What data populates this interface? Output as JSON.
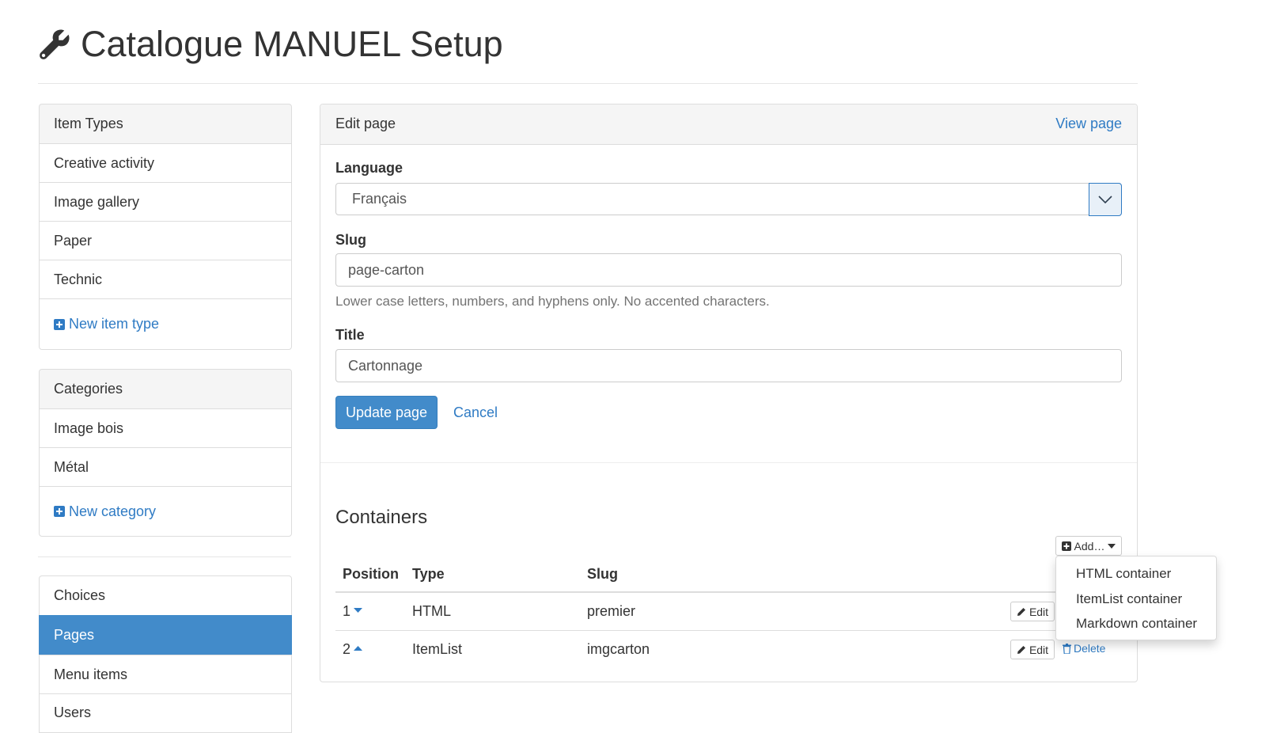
{
  "header": {
    "title": "Catalogue MANUEL Setup",
    "icon": "wrench-icon"
  },
  "sidebar": {
    "item_types": {
      "heading": "Item Types",
      "items": [
        "Creative activity",
        "Image gallery",
        "Paper",
        "Technic"
      ],
      "new_label": "New item type"
    },
    "categories": {
      "heading": "Categories",
      "items": [
        "Image bois",
        "Métal"
      ],
      "new_label": "New category"
    },
    "nav": {
      "items": [
        "Choices",
        "Pages",
        "Menu items",
        "Users"
      ],
      "active": "Pages"
    }
  },
  "main": {
    "heading": "Edit page",
    "view_link": "View page",
    "form": {
      "language_label": "Language",
      "language_value": "Français",
      "slug_label": "Slug",
      "slug_value": "page-carton",
      "slug_help": "Lower case letters, numbers, and hyphens only. No accented characters.",
      "title_label": "Title",
      "title_value": "Cartonnage",
      "submit_label": "Update page",
      "cancel_label": "Cancel"
    },
    "containers": {
      "heading": "Containers",
      "add_label": "Add…",
      "add_menu": [
        "HTML container",
        "ItemList container",
        "Markdown container"
      ],
      "columns": [
        "Position",
        "Type",
        "Slug"
      ],
      "rows": [
        {
          "position": "1",
          "type": "HTML",
          "slug": "premier",
          "edit": "Edit"
        },
        {
          "position": "2",
          "type": "ItemList",
          "slug": "imgcarton",
          "edit": "Edit",
          "delete": "Delete"
        }
      ]
    }
  },
  "colors": {
    "primary": "#428bca",
    "link": "#2f7bc4",
    "panel_heading": "#f5f5f5"
  }
}
